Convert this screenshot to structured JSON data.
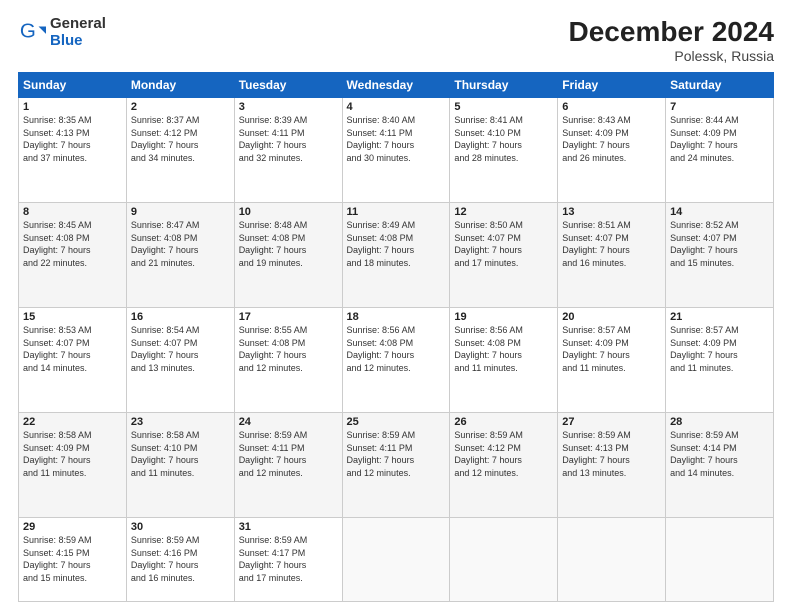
{
  "logo": {
    "general": "General",
    "blue": "Blue"
  },
  "title": {
    "month_year": "December 2024",
    "location": "Polessk, Russia"
  },
  "weekdays": [
    "Sunday",
    "Monday",
    "Tuesday",
    "Wednesday",
    "Thursday",
    "Friday",
    "Saturday"
  ],
  "weeks": [
    [
      {
        "day": "1",
        "info": "Sunrise: 8:35 AM\nSunset: 4:13 PM\nDaylight: 7 hours\nand 37 minutes."
      },
      {
        "day": "2",
        "info": "Sunrise: 8:37 AM\nSunset: 4:12 PM\nDaylight: 7 hours\nand 34 minutes."
      },
      {
        "day": "3",
        "info": "Sunrise: 8:39 AM\nSunset: 4:11 PM\nDaylight: 7 hours\nand 32 minutes."
      },
      {
        "day": "4",
        "info": "Sunrise: 8:40 AM\nSunset: 4:11 PM\nDaylight: 7 hours\nand 30 minutes."
      },
      {
        "day": "5",
        "info": "Sunrise: 8:41 AM\nSunset: 4:10 PM\nDaylight: 7 hours\nand 28 minutes."
      },
      {
        "day": "6",
        "info": "Sunrise: 8:43 AM\nSunset: 4:09 PM\nDaylight: 7 hours\nand 26 minutes."
      },
      {
        "day": "7",
        "info": "Sunrise: 8:44 AM\nSunset: 4:09 PM\nDaylight: 7 hours\nand 24 minutes."
      }
    ],
    [
      {
        "day": "8",
        "info": "Sunrise: 8:45 AM\nSunset: 4:08 PM\nDaylight: 7 hours\nand 22 minutes."
      },
      {
        "day": "9",
        "info": "Sunrise: 8:47 AM\nSunset: 4:08 PM\nDaylight: 7 hours\nand 21 minutes."
      },
      {
        "day": "10",
        "info": "Sunrise: 8:48 AM\nSunset: 4:08 PM\nDaylight: 7 hours\nand 19 minutes."
      },
      {
        "day": "11",
        "info": "Sunrise: 8:49 AM\nSunset: 4:08 PM\nDaylight: 7 hours\nand 18 minutes."
      },
      {
        "day": "12",
        "info": "Sunrise: 8:50 AM\nSunset: 4:07 PM\nDaylight: 7 hours\nand 17 minutes."
      },
      {
        "day": "13",
        "info": "Sunrise: 8:51 AM\nSunset: 4:07 PM\nDaylight: 7 hours\nand 16 minutes."
      },
      {
        "day": "14",
        "info": "Sunrise: 8:52 AM\nSunset: 4:07 PM\nDaylight: 7 hours\nand 15 minutes."
      }
    ],
    [
      {
        "day": "15",
        "info": "Sunrise: 8:53 AM\nSunset: 4:07 PM\nDaylight: 7 hours\nand 14 minutes."
      },
      {
        "day": "16",
        "info": "Sunrise: 8:54 AM\nSunset: 4:07 PM\nDaylight: 7 hours\nand 13 minutes."
      },
      {
        "day": "17",
        "info": "Sunrise: 8:55 AM\nSunset: 4:08 PM\nDaylight: 7 hours\nand 12 minutes."
      },
      {
        "day": "18",
        "info": "Sunrise: 8:56 AM\nSunset: 4:08 PM\nDaylight: 7 hours\nand 12 minutes."
      },
      {
        "day": "19",
        "info": "Sunrise: 8:56 AM\nSunset: 4:08 PM\nDaylight: 7 hours\nand 11 minutes."
      },
      {
        "day": "20",
        "info": "Sunrise: 8:57 AM\nSunset: 4:09 PM\nDaylight: 7 hours\nand 11 minutes."
      },
      {
        "day": "21",
        "info": "Sunrise: 8:57 AM\nSunset: 4:09 PM\nDaylight: 7 hours\nand 11 minutes."
      }
    ],
    [
      {
        "day": "22",
        "info": "Sunrise: 8:58 AM\nSunset: 4:09 PM\nDaylight: 7 hours\nand 11 minutes."
      },
      {
        "day": "23",
        "info": "Sunrise: 8:58 AM\nSunset: 4:10 PM\nDaylight: 7 hours\nand 11 minutes."
      },
      {
        "day": "24",
        "info": "Sunrise: 8:59 AM\nSunset: 4:11 PM\nDaylight: 7 hours\nand 12 minutes."
      },
      {
        "day": "25",
        "info": "Sunrise: 8:59 AM\nSunset: 4:11 PM\nDaylight: 7 hours\nand 12 minutes."
      },
      {
        "day": "26",
        "info": "Sunrise: 8:59 AM\nSunset: 4:12 PM\nDaylight: 7 hours\nand 12 minutes."
      },
      {
        "day": "27",
        "info": "Sunrise: 8:59 AM\nSunset: 4:13 PM\nDaylight: 7 hours\nand 13 minutes."
      },
      {
        "day": "28",
        "info": "Sunrise: 8:59 AM\nSunset: 4:14 PM\nDaylight: 7 hours\nand 14 minutes."
      }
    ],
    [
      {
        "day": "29",
        "info": "Sunrise: 8:59 AM\nSunset: 4:15 PM\nDaylight: 7 hours\nand 15 minutes."
      },
      {
        "day": "30",
        "info": "Sunrise: 8:59 AM\nSunset: 4:16 PM\nDaylight: 7 hours\nand 16 minutes."
      },
      {
        "day": "31",
        "info": "Sunrise: 8:59 AM\nSunset: 4:17 PM\nDaylight: 7 hours\nand 17 minutes."
      },
      null,
      null,
      null,
      null
    ]
  ]
}
